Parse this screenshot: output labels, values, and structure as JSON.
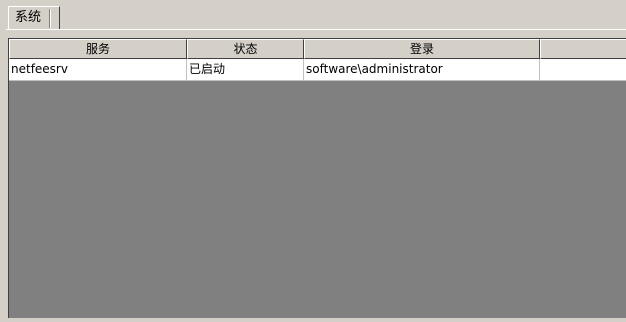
{
  "tabs": [
    {
      "label": "系统"
    }
  ],
  "table": {
    "columns": [
      "服务",
      "状态",
      "登录",
      ""
    ],
    "rows": [
      [
        "netfeesrv",
        "已启动",
        "software\\administrator",
        ""
      ]
    ]
  },
  "colors": {
    "window_bg": "#d4d0c8",
    "list_empty_bg": "#808080",
    "row_bg": "#ffffff"
  }
}
